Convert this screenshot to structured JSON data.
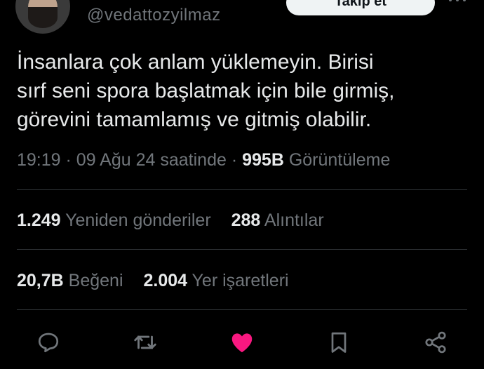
{
  "author": {
    "handle": "@vedattozyilmaz",
    "follow_label": "Takip et",
    "avatar_icon": "user-avatar"
  },
  "tweet": {
    "text": "İnsanlara çok anlam yüklemeyin. Birisi\nsırf seni spora başlatmak için bile girmiş,\ngörevini tamamlamış ve gitmiş olabilir.",
    "time": "19:19",
    "sep": "·",
    "date": "09 Ağu 24 saatinde",
    "views_count": "995B",
    "views_label": "Görüntüleme"
  },
  "stats": {
    "reposts_count": "1.249",
    "reposts_label": "Yeniden gönderiler",
    "quotes_count": "288",
    "quotes_label": "Alıntılar",
    "likes_count": "20,7B",
    "likes_label": "Beğeni",
    "bookmarks_count": "2.004",
    "bookmarks_label": "Yer işaretleri"
  },
  "actions": [
    "reply-icon",
    "repost-icon",
    "like-icon",
    "bookmark-icon",
    "share-icon"
  ],
  "colors": {
    "background": "#000000",
    "text": "#e7e9ea",
    "muted": "#71767b",
    "divider": "#2f3336",
    "like": "#f91880"
  }
}
